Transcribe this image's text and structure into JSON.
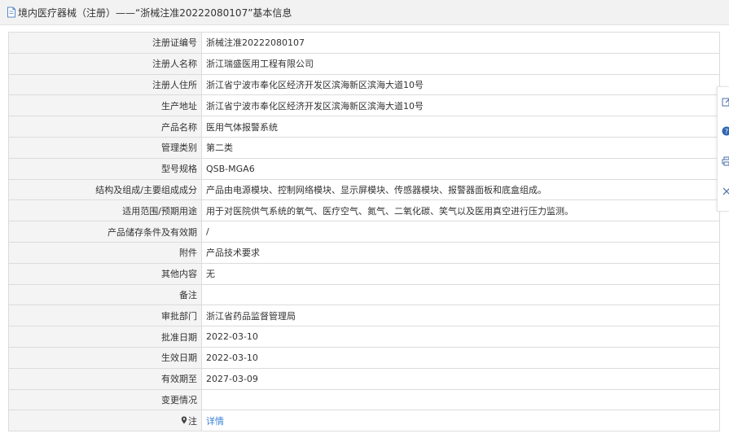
{
  "header": {
    "title": "境内医疗器械（注册）——“浙械注准20222080107”基本信息"
  },
  "rows": [
    {
      "label": "注册证编号",
      "value": "浙械注准20222080107"
    },
    {
      "label": "注册人名称",
      "value": "浙江瑞盛医用工程有限公司"
    },
    {
      "label": "注册人住所",
      "value": "浙江省宁波市奉化区经济开发区滨海新区滨海大道10号"
    },
    {
      "label": "生产地址",
      "value": "浙江省宁波市奉化区经济开发区滨海新区滨海大道10号"
    },
    {
      "label": "产品名称",
      "value": "医用气体报警系统"
    },
    {
      "label": "管理类别",
      "value": "第二类"
    },
    {
      "label": "型号规格",
      "value": "QSB-MGA6"
    },
    {
      "label": "结构及组成/主要组成成分",
      "value": "产品由电源模块、控制网络模块、显示屏模块、传感器模块、报警器面板和底盒组成。"
    },
    {
      "label": "适用范围/预期用途",
      "value": "用于对医院供气系统的氧气、医疗空气、氮气、二氧化碳、笑气以及医用真空进行压力监测。"
    },
    {
      "label": "产品储存条件及有效期",
      "value": "/"
    },
    {
      "label": "附件",
      "value": "产品技术要求"
    },
    {
      "label": "其他内容",
      "value": "无"
    },
    {
      "label": "备注",
      "value": ""
    },
    {
      "label": "审批部门",
      "value": "浙江省药品监督管理局"
    },
    {
      "label": "批准日期",
      "value": "2022-03-10"
    },
    {
      "label": "生效日期",
      "value": "2022-03-10"
    },
    {
      "label": "有效期至",
      "value": "2027-03-09"
    },
    {
      "label": "变更情况",
      "value": ""
    },
    {
      "label": "注",
      "value": "详情"
    }
  ],
  "colors": {
    "link": "#3a7fd5",
    "label_bg": "#f4f4f4",
    "border": "#dcdcdc",
    "header_bg": "#f2f2f2"
  },
  "icons": {
    "header": "document-icon",
    "note": "location-pin-icon",
    "side_toolbar": [
      "edit-icon",
      "help-icon",
      "print-icon",
      "close-icon"
    ]
  }
}
